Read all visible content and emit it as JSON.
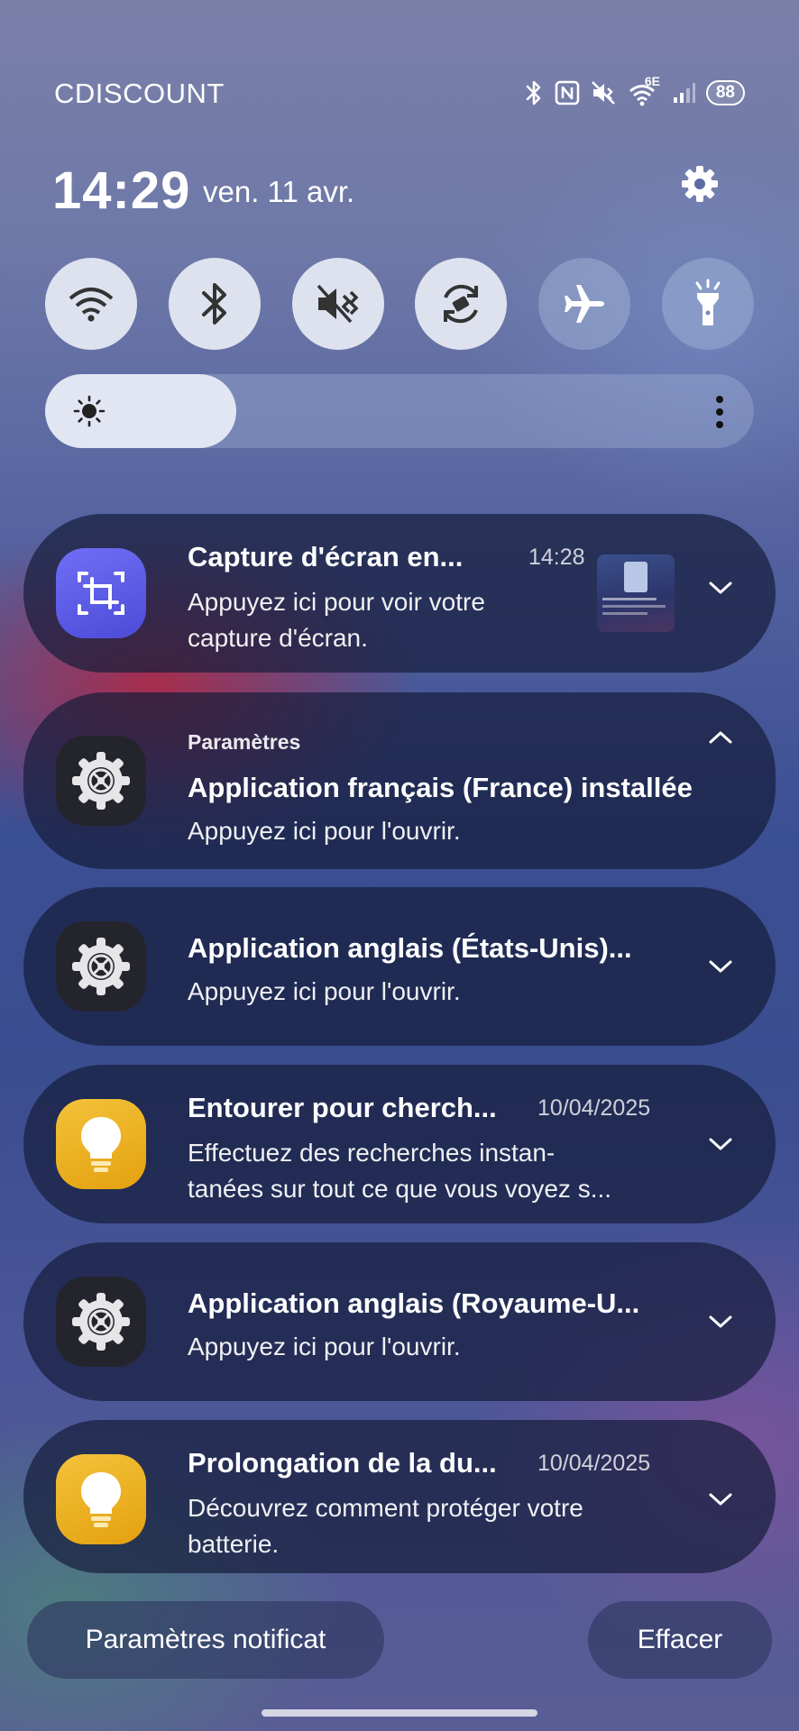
{
  "status_bar": {
    "carrier": "CDISCOUNT",
    "network_label": "6E",
    "battery": "88",
    "icons": [
      "bluetooth-icon",
      "nfc-icon",
      "mute-icon",
      "wifi-icon",
      "signal-icon"
    ]
  },
  "header": {
    "time": "14:29",
    "date": "ven. 11 avr.",
    "settings_icon": "gear-icon"
  },
  "quick_toggles": [
    {
      "name": "wifi",
      "icon": "wifi-icon",
      "active": true
    },
    {
      "name": "bluetooth",
      "icon": "bluetooth-icon",
      "active": true
    },
    {
      "name": "sound",
      "icon": "mute-icon",
      "active": true
    },
    {
      "name": "auto-rotate",
      "icon": "rotate-icon",
      "active": true
    },
    {
      "name": "airplane",
      "icon": "airplane-icon",
      "active": false
    },
    {
      "name": "flashlight",
      "icon": "flashlight-icon",
      "active": false
    }
  ],
  "brightness": {
    "level": 0.27,
    "icon": "sun-icon",
    "more_icon": "more-vertical-icon"
  },
  "notifications": [
    {
      "icon": "screenshot-icon",
      "title": "Capture d'écran en...",
      "time": "14:28",
      "body": [
        "Appuyez ici pour voir votre",
        "capture d'écran."
      ],
      "has_thumbnail": true,
      "expanded": false
    },
    {
      "icon": "settings-app-icon",
      "app": "Paramètres",
      "title": "Application français (France) installée",
      "body": [
        "Appuyez ici pour l'ouvrir."
      ],
      "expanded": true
    },
    {
      "icon": "settings-app-icon",
      "title": "Application anglais (États-Unis)...",
      "body": [
        "Appuyez ici pour l'ouvrir."
      ],
      "expanded": false
    },
    {
      "icon": "lightbulb-icon",
      "title": "Entourer pour cherch...",
      "time": "10/04/2025",
      "body": [
        "Effectuez des recherches instan-",
        "tanées sur tout ce que vous voyez s..."
      ],
      "expanded": false
    },
    {
      "icon": "settings-app-icon",
      "title": "Application anglais (Royaume-U...",
      "body": [
        "Appuyez ici pour l'ouvrir."
      ],
      "expanded": false
    },
    {
      "icon": "lightbulb-icon",
      "title": "Prolongation de la du...",
      "time": "10/04/2025",
      "body": [
        "Découvrez comment protéger votre",
        "batterie."
      ],
      "expanded": false
    }
  ],
  "footer": {
    "notification_settings": "Paramètres notificat",
    "clear": "Effacer"
  }
}
